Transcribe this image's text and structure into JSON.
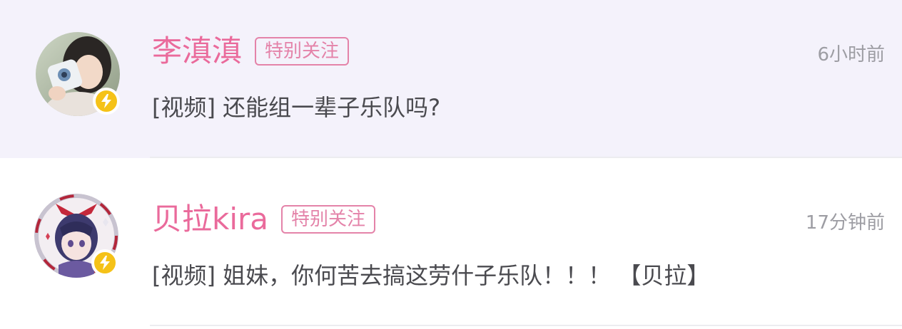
{
  "conversations": [
    {
      "name": "李滇滇",
      "tag": "特别关注",
      "time": "6小时前",
      "message": "[视频] 还能组一辈子乐队吗?"
    },
    {
      "name": "贝拉kira",
      "tag": "特别关注",
      "time": "17分钟前",
      "message": "[视频] 姐妹，你何苦去搞这劳什子乐队！！！ 【贝拉】"
    }
  ],
  "colors": {
    "name": "#ea6a9b",
    "tag": "#e483a9",
    "time": "#9d9da3",
    "message": "#4a4a4f",
    "highlight_row": "#f4f2fb",
    "badge": "#f5c218"
  },
  "icons": {
    "avatar_badge": "lightning-bolt-icon"
  }
}
